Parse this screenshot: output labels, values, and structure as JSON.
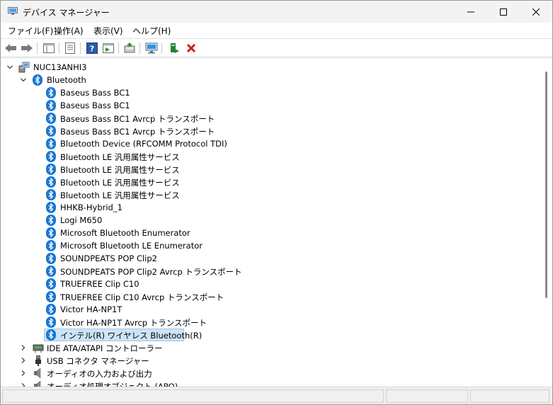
{
  "window": {
    "title": "デバイス マネージャー"
  },
  "menu": {
    "items": [
      "ファイル(F)",
      "操作(A)",
      "表示(V)",
      "ヘルプ(H)"
    ]
  },
  "toolbar": {
    "buttons": [
      "back-arrow-icon",
      "forward-arrow-icon",
      "show-hide-tree-icon",
      "properties-icon",
      "help-icon",
      "action-pane-icon",
      "update-driver-icon",
      "scan-hardware-icon",
      "enable-device-icon",
      "uninstall-device-icon"
    ]
  },
  "tree": {
    "root": "NUC13ANHI3",
    "bluetooth_category": "Bluetooth",
    "bluetooth_devices": [
      "Baseus Bass BC1",
      "Baseus Bass BC1",
      "Baseus Bass BC1 Avrcp トランスポート",
      "Baseus Bass BC1 Avrcp トランスポート",
      "Bluetooth Device (RFCOMM Protocol TDI)",
      "Bluetooth LE 汎用属性サービス",
      "Bluetooth LE 汎用属性サービス",
      "Bluetooth LE 汎用属性サービス",
      "Bluetooth LE 汎用属性サービス",
      "HHKB-Hybrid_1",
      "Logi M650",
      "Microsoft Bluetooth Enumerator",
      "Microsoft Bluetooth LE Enumerator",
      "SOUNDPEATS POP Clip2",
      "SOUNDPEATS POP Clip2 Avrcp トランスポート",
      "TRUEFREE Clip C10",
      "TRUEFREE Clip C10 Avrcp トランスポート",
      "Victor HA-NP1T",
      "Victor HA-NP1T Avrcp トランスポート",
      "インテル(R) ワイヤレス Bluetooth(R)"
    ],
    "selected_device": "インテル(R) ワイヤレス Bluetooth(R)",
    "other_categories": [
      "IDE ATA/ATAPI コントローラー",
      "USB コネクタ マネージャー",
      "オーディオの入力および出力",
      "オーディオ処理オブジェクト (APO)"
    ]
  },
  "colors": {
    "bluetooth": "#1877d4",
    "selection": "#cce4f7",
    "selection_border": "#99c9ef"
  }
}
